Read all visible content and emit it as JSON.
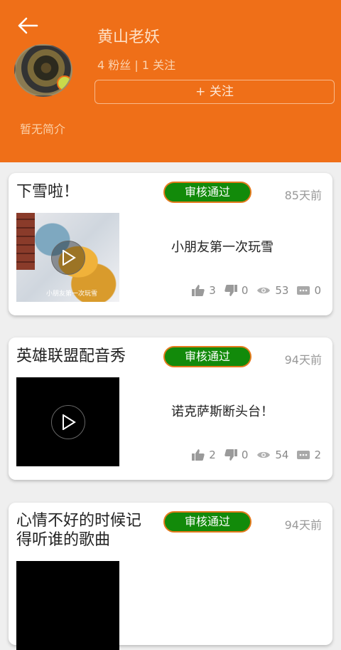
{
  "profile": {
    "name": "黄山老妖",
    "stats": "4 粉丝 | 1 关注",
    "follow_label": "+ 关注",
    "bio": "暂无简介"
  },
  "posts": [
    {
      "title": "下雪啦！",
      "status": "审核通过",
      "age": "85天前",
      "description": "小朋友第一次玩雪",
      "thumb_caption": "小朋友第一次玩雪",
      "likes": "3",
      "dislikes": "0",
      "views": "53",
      "comments": "0"
    },
    {
      "title": "英雄联盟配音秀",
      "status": "审核通过",
      "age": "94天前",
      "description": "诺克萨斯断头台！",
      "likes": "2",
      "dislikes": "0",
      "views": "54",
      "comments": "2"
    },
    {
      "title_line1": "心情不好的时候记",
      "title_line2": "得听谁的歌曲",
      "status": "审核通过",
      "age": "94天前"
    }
  ],
  "colors": {
    "header": "#ef6f18",
    "approved_badge": "#128a0a",
    "badge_border": "#e37a1c"
  }
}
